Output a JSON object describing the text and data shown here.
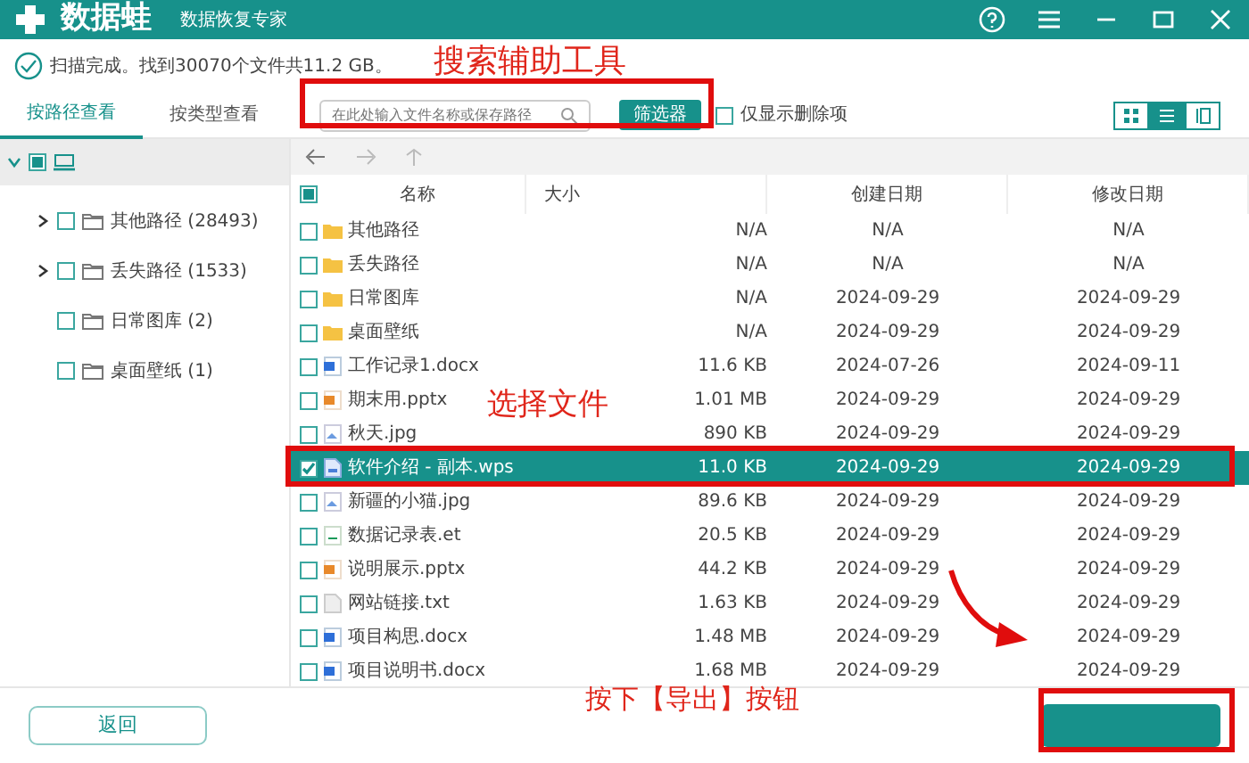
{
  "app": {
    "name": "数据蛙",
    "subtitle": "数据恢复专家"
  },
  "status_text": "扫描完成。找到30070个文件共11.2 GB。",
  "left_tabs": [
    {
      "label": "按路径查看",
      "selected": true
    },
    {
      "label": "按类型查看",
      "selected": false
    }
  ],
  "search": {
    "placeholder": "在此处输入文件名称或保存路径"
  },
  "filter_button": "筛选器",
  "deleted_only": {
    "label": "仅显示删除项",
    "checked": false
  },
  "view_modes": [
    {
      "kind": "grid",
      "selected": false
    },
    {
      "kind": "list",
      "selected": true
    },
    {
      "kind": "columns",
      "selected": false
    }
  ],
  "tree": {
    "expanded": true,
    "partially_checked": true,
    "children": [
      {
        "label": "其他路径 (28493)",
        "expandable": true,
        "checked": false
      },
      {
        "label": "丢失路径 (1533)",
        "expandable": true,
        "checked": false
      },
      {
        "label": "日常图库 (2)",
        "expandable": false,
        "checked": false
      },
      {
        "label": "桌面壁纸 (1)",
        "expandable": false,
        "checked": false
      }
    ]
  },
  "table": {
    "header_partially_checked": true,
    "columns": [
      "名称",
      "大小",
      "创建日期",
      "修改日期"
    ],
    "rows": [
      {
        "kind": "folder",
        "name": "其他路径",
        "size": "N/A",
        "created": "N/A",
        "modified": "N/A",
        "checked": false,
        "selected": false
      },
      {
        "kind": "folder",
        "name": "丢失路径",
        "size": "N/A",
        "created": "N/A",
        "modified": "N/A",
        "checked": false,
        "selected": false
      },
      {
        "kind": "folder",
        "name": "日常图库",
        "size": "N/A",
        "created": "2024-09-29",
        "modified": "2024-09-29",
        "checked": false,
        "selected": false
      },
      {
        "kind": "folder",
        "name": "桌面壁纸",
        "size": "N/A",
        "created": "2024-09-29",
        "modified": "2024-09-29",
        "checked": false,
        "selected": false
      },
      {
        "kind": "doc",
        "name": "工作记录1.docx",
        "size": "11.6 KB",
        "created": "2024-07-26",
        "modified": "2024-09-11",
        "checked": false,
        "selected": false
      },
      {
        "kind": "ppt",
        "name": "期末用.pptx",
        "size": "1.01 MB",
        "created": "2024-09-29",
        "modified": "2024-09-29",
        "checked": false,
        "selected": false
      },
      {
        "kind": "image",
        "name": "秋天.jpg",
        "size": "890 KB",
        "created": "2024-09-29",
        "modified": "2024-09-29",
        "checked": false,
        "selected": false
      },
      {
        "kind": "wps",
        "name": "软件介绍 - 副本.wps",
        "size": "11.0 KB",
        "created": "2024-09-29",
        "modified": "2024-09-29",
        "checked": true,
        "selected": true
      },
      {
        "kind": "image",
        "name": "新疆的小猫.jpg",
        "size": "89.6 KB",
        "created": "2024-09-29",
        "modified": "2024-09-29",
        "checked": false,
        "selected": false
      },
      {
        "kind": "sheet",
        "name": "数据记录表.et",
        "size": "20.5 KB",
        "created": "2024-09-29",
        "modified": "2024-09-29",
        "checked": false,
        "selected": false
      },
      {
        "kind": "ppt",
        "name": "说明展示.pptx",
        "size": "44.2 KB",
        "created": "2024-09-29",
        "modified": "2024-09-29",
        "checked": false,
        "selected": false
      },
      {
        "kind": "text",
        "name": "网站链接.txt",
        "size": "1.63 KB",
        "created": "2024-09-29",
        "modified": "2024-09-29",
        "checked": false,
        "selected": false
      },
      {
        "kind": "doc",
        "name": "项目构思.docx",
        "size": "1.48 MB",
        "created": "2024-09-29",
        "modified": "2024-09-29",
        "checked": false,
        "selected": false
      },
      {
        "kind": "doc",
        "name": "项目说明书.docx",
        "size": "1.68 MB",
        "created": "2024-09-29",
        "modified": "2024-09-29",
        "checked": false,
        "selected": false
      }
    ]
  },
  "back_button": "返回",
  "annotations": [
    {
      "kind": "label",
      "text": "搜索辅助工具"
    },
    {
      "kind": "box"
    },
    {
      "kind": "label",
      "text": "选择文件"
    },
    {
      "kind": "box"
    },
    {
      "kind": "arrow"
    },
    {
      "kind": "label",
      "text": "按下【导出】按钮"
    },
    {
      "kind": "box"
    }
  ]
}
